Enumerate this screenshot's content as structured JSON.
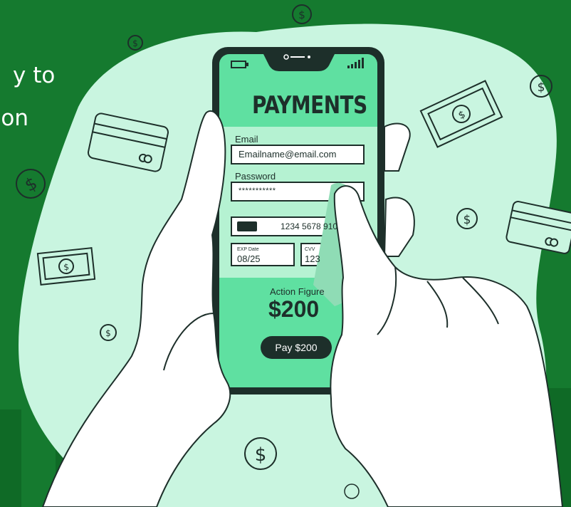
{
  "heading_fragments": [
    "y to",
    "on"
  ],
  "phone": {
    "title": "PAYMENTS",
    "email_label": "Email",
    "email_value": "Emailname@email.com",
    "password_label": "Password",
    "password_value": "***********",
    "card_number": "1234 5678 910",
    "exp_label": "EXP Date",
    "exp_value": "08/25",
    "cvv_label": "CVV",
    "cvv_value": "123",
    "product": "Action Figure",
    "price": "$200",
    "pay_button": "Pay $200"
  },
  "colors": {
    "background": "#157a2f",
    "blob": "#c9f5e0",
    "screen": "#5fe0a1",
    "phone_frame": "#1d2f2a",
    "outline": "#1d2f2a"
  },
  "icons": [
    "dollar-coin-icon",
    "cash-bill-icon",
    "credit-card-icon",
    "hand-icon",
    "smartphone-icon",
    "signal-icon",
    "battery-icon"
  ]
}
